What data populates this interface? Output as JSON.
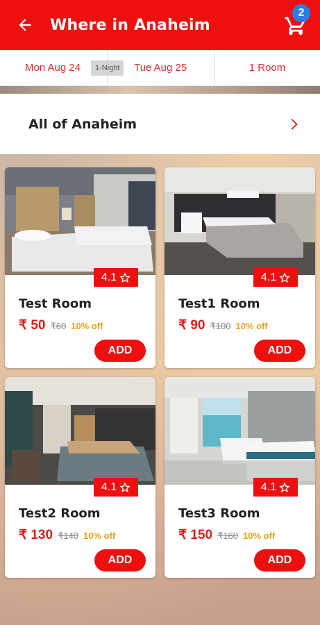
{
  "header": {
    "title": "Where in Anaheim",
    "back_icon": "back-arrow-icon",
    "cart_icon": "cart-icon",
    "cart_count": "2"
  },
  "booking": {
    "check_in": "Mon Aug 24",
    "nights": "1-Night",
    "check_out": "Tue Aug 25",
    "rooms": "1 Room"
  },
  "area": {
    "label": "All of Anaheim",
    "icon": "chevron-right-icon"
  },
  "colors": {
    "primary": "#ee0f0f",
    "badge": "#2e7be6",
    "discount": "#e3a21a"
  },
  "rooms": [
    {
      "name": "Test Room",
      "price": "₹ 50",
      "old_price": "₹60",
      "discount": "10% off",
      "rating": "4.1",
      "add_label": "ADD"
    },
    {
      "name": "Test1 Room",
      "price": "₹ 90",
      "old_price": "₹100",
      "discount": "10% off",
      "rating": "4.1",
      "add_label": "ADD"
    },
    {
      "name": "Test2 Room",
      "price": "₹ 130",
      "old_price": "₹140",
      "discount": "10% off",
      "rating": "4.1",
      "add_label": "ADD"
    },
    {
      "name": "Test3 Room",
      "price": "₹ 150",
      "old_price": "₹160",
      "discount": "10% off",
      "rating": "4.1",
      "add_label": "ADD"
    }
  ]
}
